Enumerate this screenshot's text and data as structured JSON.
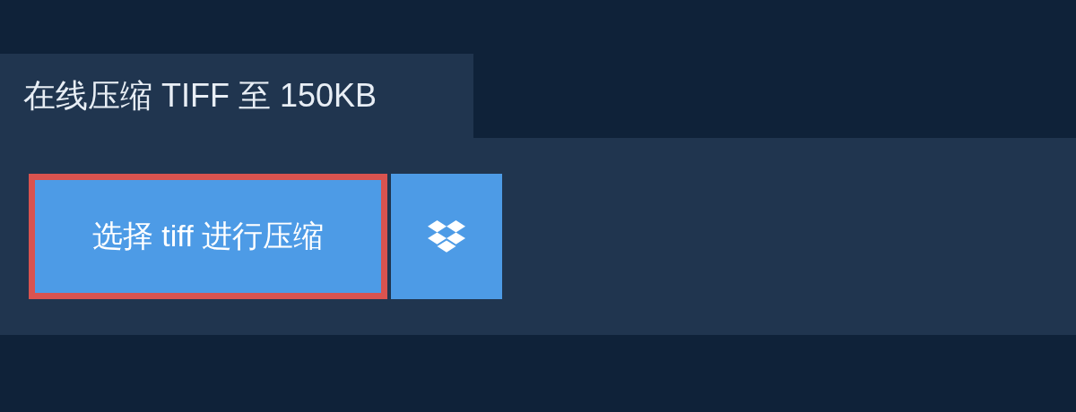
{
  "tab": {
    "title": "在线压缩 TIFF 至 150KB"
  },
  "buttons": [
    {
      "kind": "upload",
      "label": "选择 tiff 进行压缩",
      "focused": true
    },
    {
      "kind": "dropbox"
    }
  ]
}
